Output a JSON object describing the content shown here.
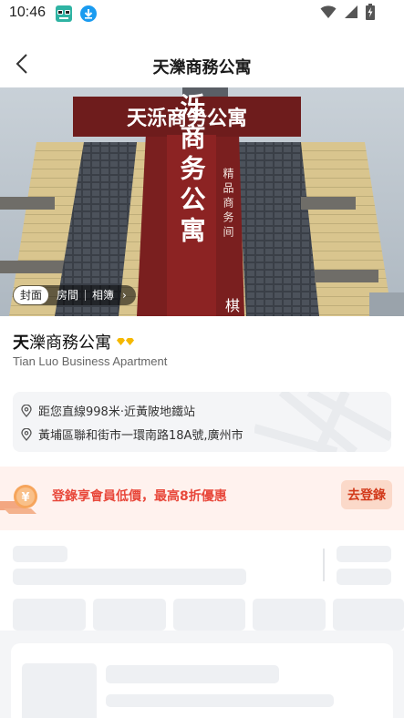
{
  "status_bar": {
    "time": "10:46",
    "app_icon": "glasses-app-icon",
    "download_icon": "download-circle-icon",
    "wifi_icon": "wifi-icon",
    "signal_icon": "cellular-signal-icon",
    "battery_icon": "battery-charging-icon"
  },
  "header": {
    "back_icon": "chevron-left-icon",
    "title": "天濼商務公寓"
  },
  "hero": {
    "tabs": [
      {
        "label": "封面",
        "active": true
      },
      {
        "label": "房間",
        "active": false
      },
      {
        "label": "相簿",
        "active": false
      }
    ],
    "more_icon": "chevron-right-icon",
    "sign_main": "天泺商务公寓",
    "sign_vertical": "天泺商务公寓",
    "sign_side": "精品商务间",
    "sign_extra": "棋"
  },
  "hotel": {
    "name_first": "天",
    "name_rest": "濼商務公寓",
    "badge_icon": "diamond-badge-icon",
    "badge_color": "#f5b800",
    "name_en": "Tian Luo Business Apartment",
    "distance": "距您直線998米·近黃陂地鐵站",
    "address": "黃埔區聯和街市一環南路18A號,廣州市"
  },
  "promo": {
    "coin_icon": "yuan-coin-icon",
    "text": "登錄享會員低價，最高8折優惠",
    "button": "去登錄",
    "accent": "#e8483b"
  }
}
